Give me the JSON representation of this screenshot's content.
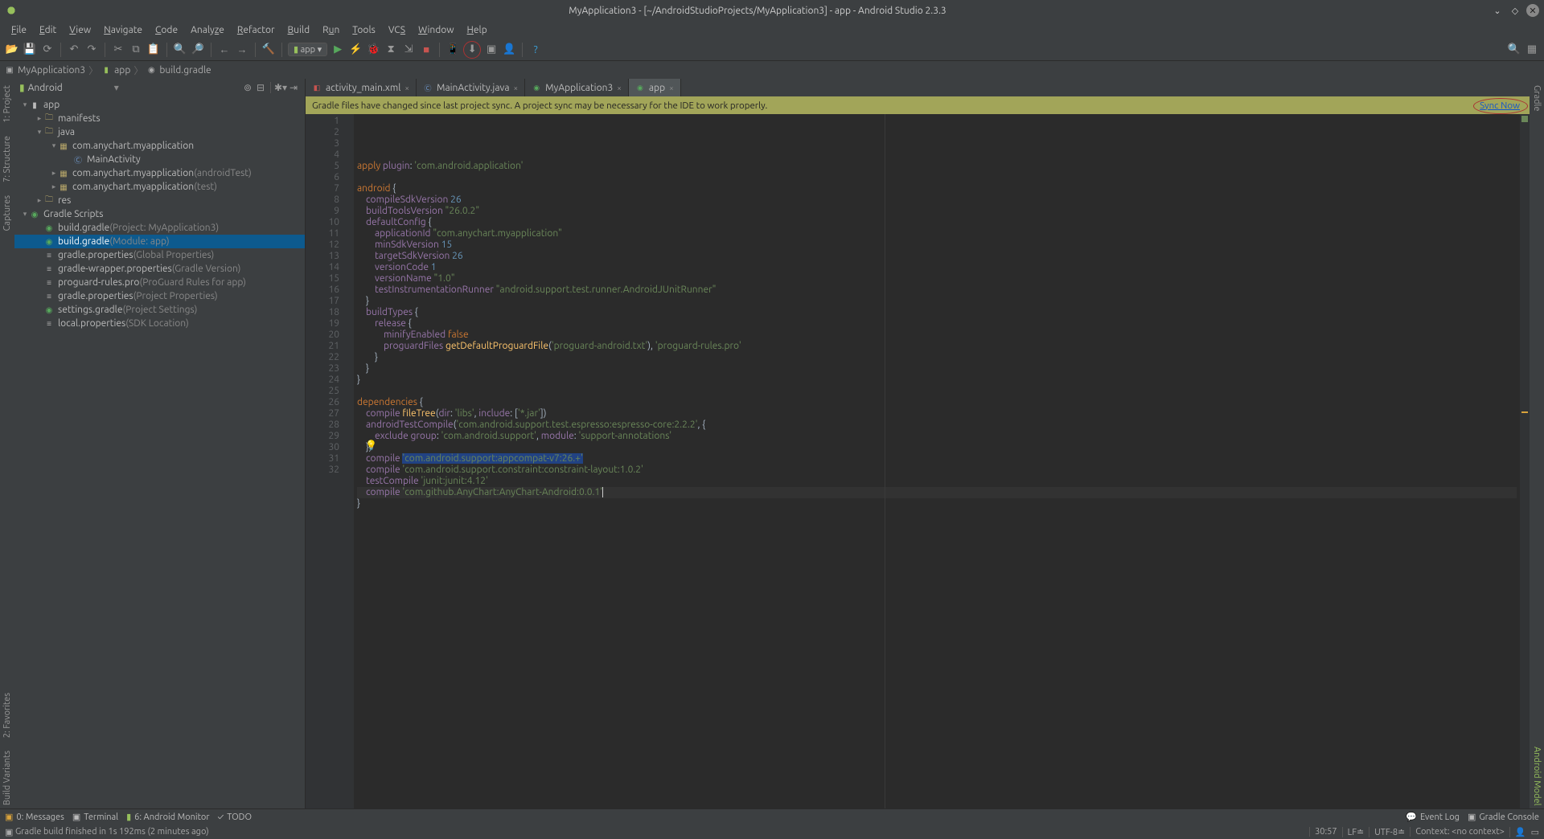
{
  "window": {
    "title": "MyApplication3 - [~/AndroidStudioProjects/MyApplication3] - app - Android Studio 2.3.3"
  },
  "menu": [
    "File",
    "Edit",
    "View",
    "Navigate",
    "Code",
    "Analyze",
    "Refactor",
    "Build",
    "Run",
    "Tools",
    "VCS",
    "Window",
    "Help"
  ],
  "toolbar": {
    "config": "app"
  },
  "breadcrumb": [
    {
      "label": "MyApplication3",
      "icon": "folder"
    },
    {
      "label": "app",
      "icon": "android"
    },
    {
      "label": "build.gradle",
      "icon": "gradle"
    }
  ],
  "project": {
    "mode": "Android",
    "tree": [
      {
        "ind": 0,
        "exp": "▾",
        "icon": "android",
        "label": "app"
      },
      {
        "ind": 1,
        "exp": "▸",
        "icon": "folder",
        "label": "manifests"
      },
      {
        "ind": 1,
        "exp": "▾",
        "icon": "folder",
        "label": "java"
      },
      {
        "ind": 2,
        "exp": "▾",
        "icon": "pkg",
        "label": "com.anychart.myapplication"
      },
      {
        "ind": 3,
        "icon": "class",
        "label": "MainActivity"
      },
      {
        "ind": 2,
        "exp": "▸",
        "icon": "pkg",
        "label": "com.anychart.myapplication",
        "suffix": "(androidTest)"
      },
      {
        "ind": 2,
        "exp": "▸",
        "icon": "pkg",
        "label": "com.anychart.myapplication",
        "suffix": "(test)"
      },
      {
        "ind": 1,
        "exp": "▸",
        "icon": "folder",
        "label": "res"
      },
      {
        "ind": 0,
        "exp": "▾",
        "icon": "gradle",
        "label": "Gradle Scripts"
      },
      {
        "ind": 1,
        "icon": "gradle",
        "label": "build.gradle",
        "suffix": "(Project: MyApplication3)"
      },
      {
        "ind": 1,
        "icon": "gradle",
        "label": "build.gradle",
        "suffix": "(Module: app)",
        "sel": true
      },
      {
        "ind": 1,
        "icon": "prop",
        "label": "gradle.properties",
        "suffix": "(Global Properties)"
      },
      {
        "ind": 1,
        "icon": "prop",
        "label": "gradle-wrapper.properties",
        "suffix": "(Gradle Version)"
      },
      {
        "ind": 1,
        "icon": "prop",
        "label": "proguard-rules.pro",
        "suffix": "(ProGuard Rules for app)"
      },
      {
        "ind": 1,
        "icon": "prop",
        "label": "gradle.properties",
        "suffix": "(Project Properties)"
      },
      {
        "ind": 1,
        "icon": "gradle",
        "label": "settings.gradle",
        "suffix": "(Project Settings)"
      },
      {
        "ind": 1,
        "icon": "prop",
        "label": "local.properties",
        "suffix": "(SDK Location)"
      }
    ]
  },
  "tabs": [
    {
      "label": "activity_main.xml",
      "icon": "xml"
    },
    {
      "label": "MainActivity.java",
      "icon": "class"
    },
    {
      "label": "MyApplication3",
      "icon": "gradle"
    },
    {
      "label": "app",
      "icon": "gradle",
      "active": true
    }
  ],
  "notification": {
    "text": "Gradle files have changed since last project sync. A project sync may be necessary for the IDE to work properly.",
    "action": "Sync Now"
  },
  "code_lines": 32,
  "bottom_tabs": [
    "0: Messages",
    "Terminal",
    "6: Android Monitor",
    "TODO"
  ],
  "bottom_right": [
    "Event Log",
    "Gradle Console"
  ],
  "status": {
    "message": "Gradle build finished in 1s 192ms (2 minutes ago)",
    "pos": "30:57",
    "sep": "LF≐",
    "enc": "UTF-8≐",
    "context": "Context: <no context>"
  },
  "left_gutter": [
    "1: Project",
    "7: Structure",
    "Captures",
    "2: Favorites",
    "Build Variants"
  ],
  "right_gutter": [
    "Gradle",
    "Android Model"
  ]
}
